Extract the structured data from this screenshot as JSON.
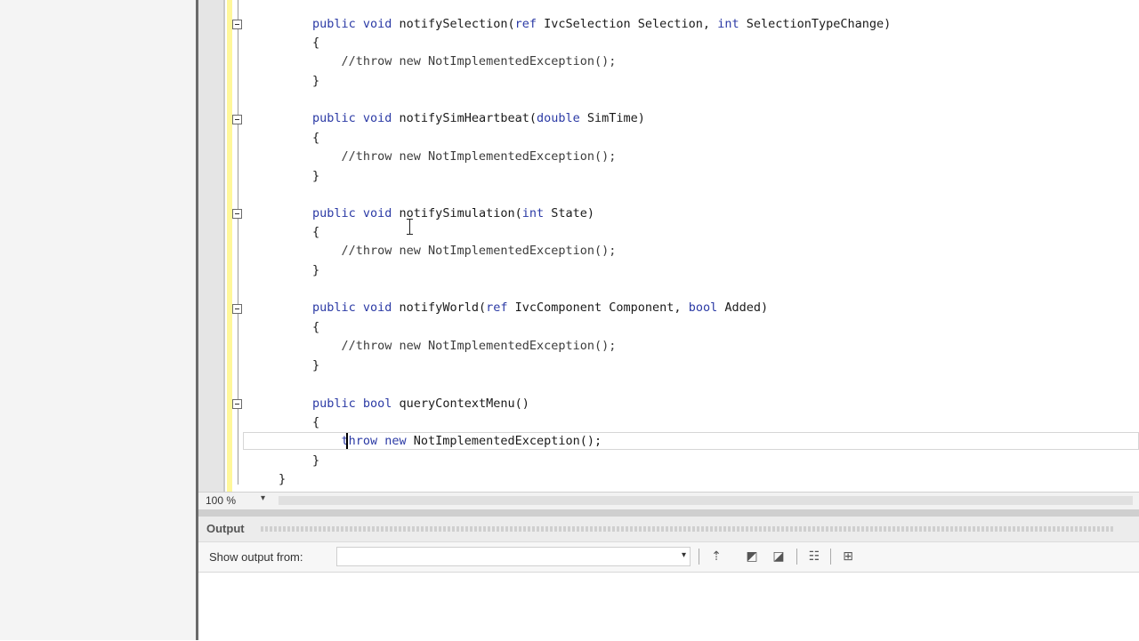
{
  "editor": {
    "lines": [
      {
        "id": "l1",
        "segments": [
          {
            "t": "public void ",
            "c": "kw"
          },
          {
            "t": "notifySelection(",
            "c": ""
          },
          {
            "t": "ref ",
            "c": "kw"
          },
          {
            "t": "IvcSelection Selection, ",
            "c": ""
          },
          {
            "t": "int ",
            "c": "kw"
          },
          {
            "t": "SelectionTypeChange)",
            "c": ""
          }
        ]
      },
      {
        "id": "l2",
        "segments": [
          {
            "t": "{",
            "c": ""
          }
        ]
      },
      {
        "id": "l3",
        "segments": [
          {
            "t": "    //throw new NotImplementedException();",
            "c": "cm"
          }
        ]
      },
      {
        "id": "l4",
        "segments": [
          {
            "t": "}",
            "c": ""
          }
        ]
      },
      {
        "id": "l5",
        "segments": [
          {
            "t": "public void ",
            "c": "kw"
          },
          {
            "t": "notifySimHeartbeat(",
            "c": ""
          },
          {
            "t": "double ",
            "c": "kw"
          },
          {
            "t": "SimTime)",
            "c": ""
          }
        ]
      },
      {
        "id": "l6",
        "segments": [
          {
            "t": "{",
            "c": ""
          }
        ]
      },
      {
        "id": "l7",
        "segments": [
          {
            "t": "    //throw new NotImplementedException();",
            "c": "cm"
          }
        ]
      },
      {
        "id": "l8",
        "segments": [
          {
            "t": "}",
            "c": ""
          }
        ]
      },
      {
        "id": "l9",
        "segments": [
          {
            "t": "public void ",
            "c": "kw"
          },
          {
            "t": "notifySimulation(",
            "c": ""
          },
          {
            "t": "int ",
            "c": "kw"
          },
          {
            "t": "State)",
            "c": ""
          }
        ]
      },
      {
        "id": "l10",
        "segments": [
          {
            "t": "{",
            "c": ""
          }
        ]
      },
      {
        "id": "l11",
        "segments": [
          {
            "t": "    //throw new NotImplementedException();",
            "c": "cm"
          }
        ]
      },
      {
        "id": "l12",
        "segments": [
          {
            "t": "}",
            "c": ""
          }
        ]
      },
      {
        "id": "l13",
        "segments": [
          {
            "t": "public void ",
            "c": "kw"
          },
          {
            "t": "notifyWorld(",
            "c": ""
          },
          {
            "t": "ref ",
            "c": "kw"
          },
          {
            "t": "IvcComponent Component, ",
            "c": ""
          },
          {
            "t": "bool ",
            "c": "kw"
          },
          {
            "t": "Added)",
            "c": ""
          }
        ]
      },
      {
        "id": "l14",
        "segments": [
          {
            "t": "{",
            "c": ""
          }
        ]
      },
      {
        "id": "l15",
        "segments": [
          {
            "t": "    //throw new NotImplementedException();",
            "c": "cm"
          }
        ]
      },
      {
        "id": "l16",
        "segments": [
          {
            "t": "}",
            "c": ""
          }
        ]
      },
      {
        "id": "l17",
        "segments": [
          {
            "t": "public bool ",
            "c": "kw"
          },
          {
            "t": "queryContextMenu()",
            "c": ""
          }
        ]
      },
      {
        "id": "l18",
        "segments": [
          {
            "t": "{",
            "c": ""
          }
        ]
      },
      {
        "id": "l19",
        "segments": [
          {
            "t": "    ",
            "c": ""
          },
          {
            "t": "throw new ",
            "c": "kw"
          },
          {
            "t": "NotImplementedException();",
            "c": ""
          }
        ]
      },
      {
        "id": "l20",
        "segments": [
          {
            "t": "}",
            "c": ""
          }
        ]
      },
      {
        "id": "l21",
        "segments": [
          {
            "t": "}",
            "c": ""
          }
        ]
      }
    ]
  },
  "zoom": {
    "label": "100 %"
  },
  "output": {
    "title": "Output",
    "show_output_label": "Show output from:",
    "show_output_value": ""
  },
  "colors": {
    "keyword": "#2b3aa5",
    "change_bar": "#fff79a"
  }
}
